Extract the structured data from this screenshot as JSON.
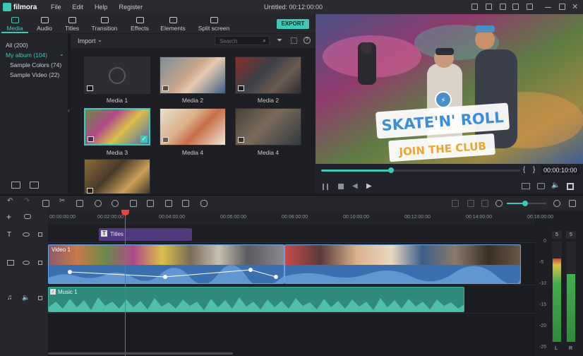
{
  "app": {
    "brand": "filmora",
    "title": "Untitled:  00:12:00:00",
    "menu": [
      "File",
      "Edit",
      "Help",
      "Register"
    ]
  },
  "tabs": [
    {
      "label": "Media",
      "active": true
    },
    {
      "label": "Audio"
    },
    {
      "label": "Titles"
    },
    {
      "label": "Transition"
    },
    {
      "label": "Effects"
    },
    {
      "label": "Elements"
    },
    {
      "label": "Split screen"
    }
  ],
  "export_label": "EXPORT",
  "album": {
    "items": [
      {
        "label": "All (200)"
      },
      {
        "label": "My album (104)",
        "selected": true
      },
      {
        "label": "Sample Colors (74)"
      },
      {
        "label": "Sample Video (22)"
      }
    ]
  },
  "media_toolbar": {
    "import_label": "Import",
    "search_placeholder": "Search"
  },
  "media": [
    {
      "label": "Media 1",
      "kind": "audio"
    },
    {
      "label": "Media 2",
      "kind": "video"
    },
    {
      "label": "Media 2",
      "kind": "video"
    },
    {
      "label": "Media 3",
      "kind": "video",
      "selected": true
    },
    {
      "label": "Media 4",
      "kind": "video"
    },
    {
      "label": "Media 4",
      "kind": "video"
    },
    {
      "label": "",
      "kind": "video"
    }
  ],
  "preview": {
    "title_line1": "SKATE'N' ROLL",
    "title_line2": "JOIN THE CLUB",
    "timecode": "00:00:10:00",
    "progress": 0.35
  },
  "ruler": {
    "ticks": [
      "00:00:00:00",
      "00:02:00:00",
      "00:04:00:00",
      "00:06:00:00",
      "00:08:00:00",
      "00:10:00:00",
      "00:12:00:00",
      "00:14:00:00",
      "00:16:00:00"
    ]
  },
  "tracks": {
    "title_clip_label": "Titles",
    "video_clip_label": "Video 1",
    "music_clip_label": "Music 1"
  },
  "meter": {
    "top_left": "5",
    "top_right": "5",
    "scale": [
      "0",
      "-5",
      "-10",
      "-15",
      "-20",
      "-25"
    ],
    "channel_left": "L",
    "channel_right": "R"
  },
  "colors": {
    "accent": "#3fc8b5",
    "video_clip": "#4a7fc2",
    "audio_clip": "#2f8a7c",
    "title_clip": "#4f3a7c",
    "playhead": "#e8473f"
  }
}
